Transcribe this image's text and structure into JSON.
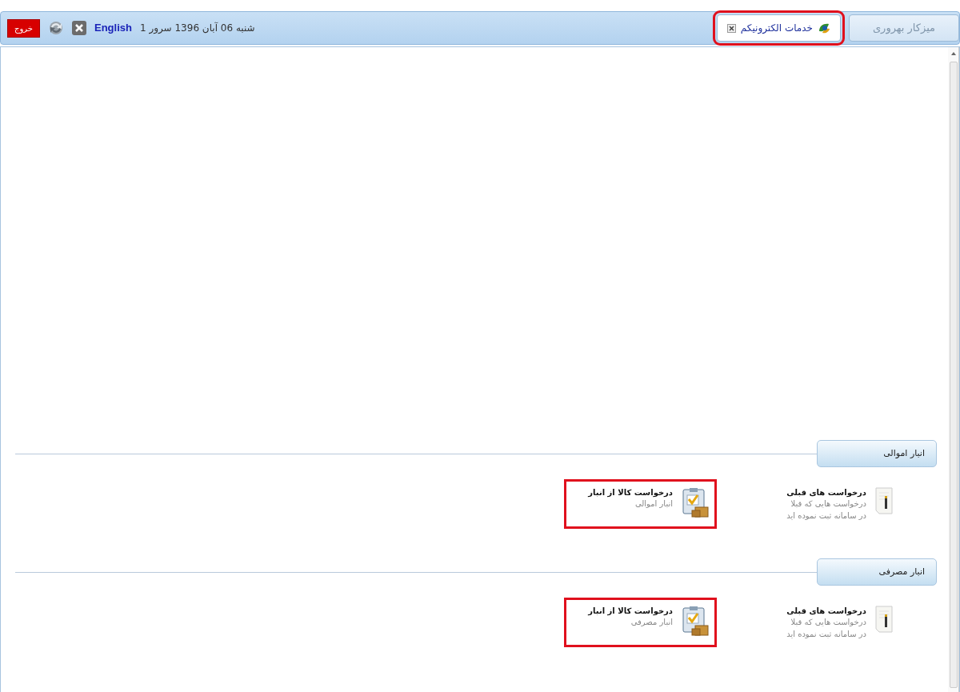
{
  "tabs": [
    {
      "label": "میزکار بهروری",
      "selected": false,
      "highlighted": false,
      "closable": false
    },
    {
      "label": "خدمات الکترونیکم",
      "selected": true,
      "highlighted": true,
      "closable": true
    }
  ],
  "toolbar": {
    "date": "شنبه 06 آبان 1396 سرور 1",
    "language_link": "English",
    "exit_button": "خروج"
  },
  "sections": [
    {
      "title": "انبار اموالی",
      "items": [
        {
          "kind": "history",
          "title": "درخواست های قبلی",
          "description_lines": [
            "درخواست هایی که قبلا",
            "در سامانه ثبت نموده اید"
          ],
          "highlighted": false
        },
        {
          "kind": "request",
          "title": "درخواست کالا از انبار",
          "description_lines": [
            "انبار اموالی"
          ],
          "highlighted": true
        }
      ]
    },
    {
      "title": "انبار مصرفی",
      "items": [
        {
          "kind": "history",
          "title": "درخواست های قبلی",
          "description_lines": [
            "درخواست هایی که قبلا",
            "در سامانه ثبت نموده اید"
          ],
          "highlighted": false
        },
        {
          "kind": "request",
          "title": "درخواست کالا از انبار",
          "description_lines": [
            "انبار مصرفی"
          ],
          "highlighted": true
        }
      ]
    }
  ]
}
